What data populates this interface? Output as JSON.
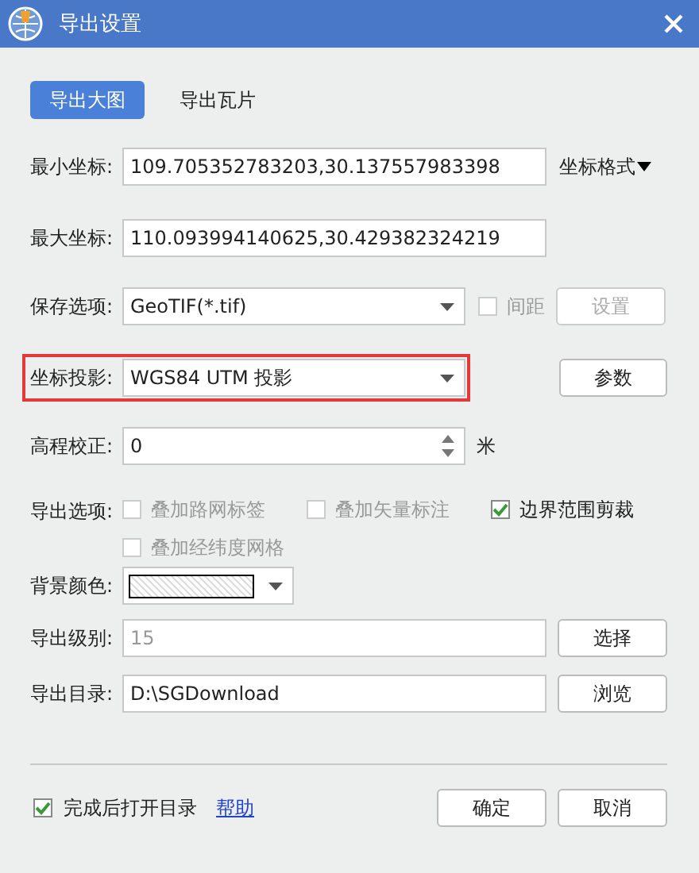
{
  "window": {
    "title": "导出设置"
  },
  "tabs": [
    {
      "label": "导出大图",
      "selected": true
    },
    {
      "label": "导出瓦片",
      "selected": false
    }
  ],
  "min_coord": {
    "label": "最小坐标:",
    "value": "109.705352783203,30.137557983398",
    "menu": "坐标格式"
  },
  "max_coord": {
    "label": "最大坐标:",
    "value": "110.093994140625,30.429382324219"
  },
  "save_option": {
    "label": "保存选项:",
    "value": "GeoTIF(*.tif)",
    "spacing": {
      "label": "间距",
      "checked": false,
      "disabled": true
    },
    "button": {
      "label": "设置",
      "disabled": true
    }
  },
  "projection": {
    "label": "坐标投影:",
    "value": "WGS84 UTM 投影",
    "highlighted": true,
    "button": "参数"
  },
  "elevation": {
    "label": "高程校正:",
    "value": "0",
    "unit": "米"
  },
  "export_options": {
    "label": "导出选项:",
    "options": [
      {
        "label": "叠加路网标签",
        "checked": false,
        "disabled": true
      },
      {
        "label": "叠加矢量标注",
        "checked": false,
        "disabled": true
      },
      {
        "label": "边界范围剪裁",
        "checked": true,
        "disabled": false
      },
      {
        "label": "叠加经纬度网格",
        "checked": false,
        "disabled": true
      }
    ]
  },
  "background_color": {
    "label": "背景颜色:"
  },
  "level": {
    "label": "导出级别:",
    "value": "15",
    "disabled": true,
    "button": "选择"
  },
  "directory": {
    "label": "导出目录:",
    "value": "D:\\SGDownload",
    "button": "浏览"
  },
  "footer": {
    "open_after": {
      "label": "完成后打开目录",
      "checked": true
    },
    "help_link": "帮助",
    "buttons": [
      "确定",
      "取消"
    ]
  }
}
